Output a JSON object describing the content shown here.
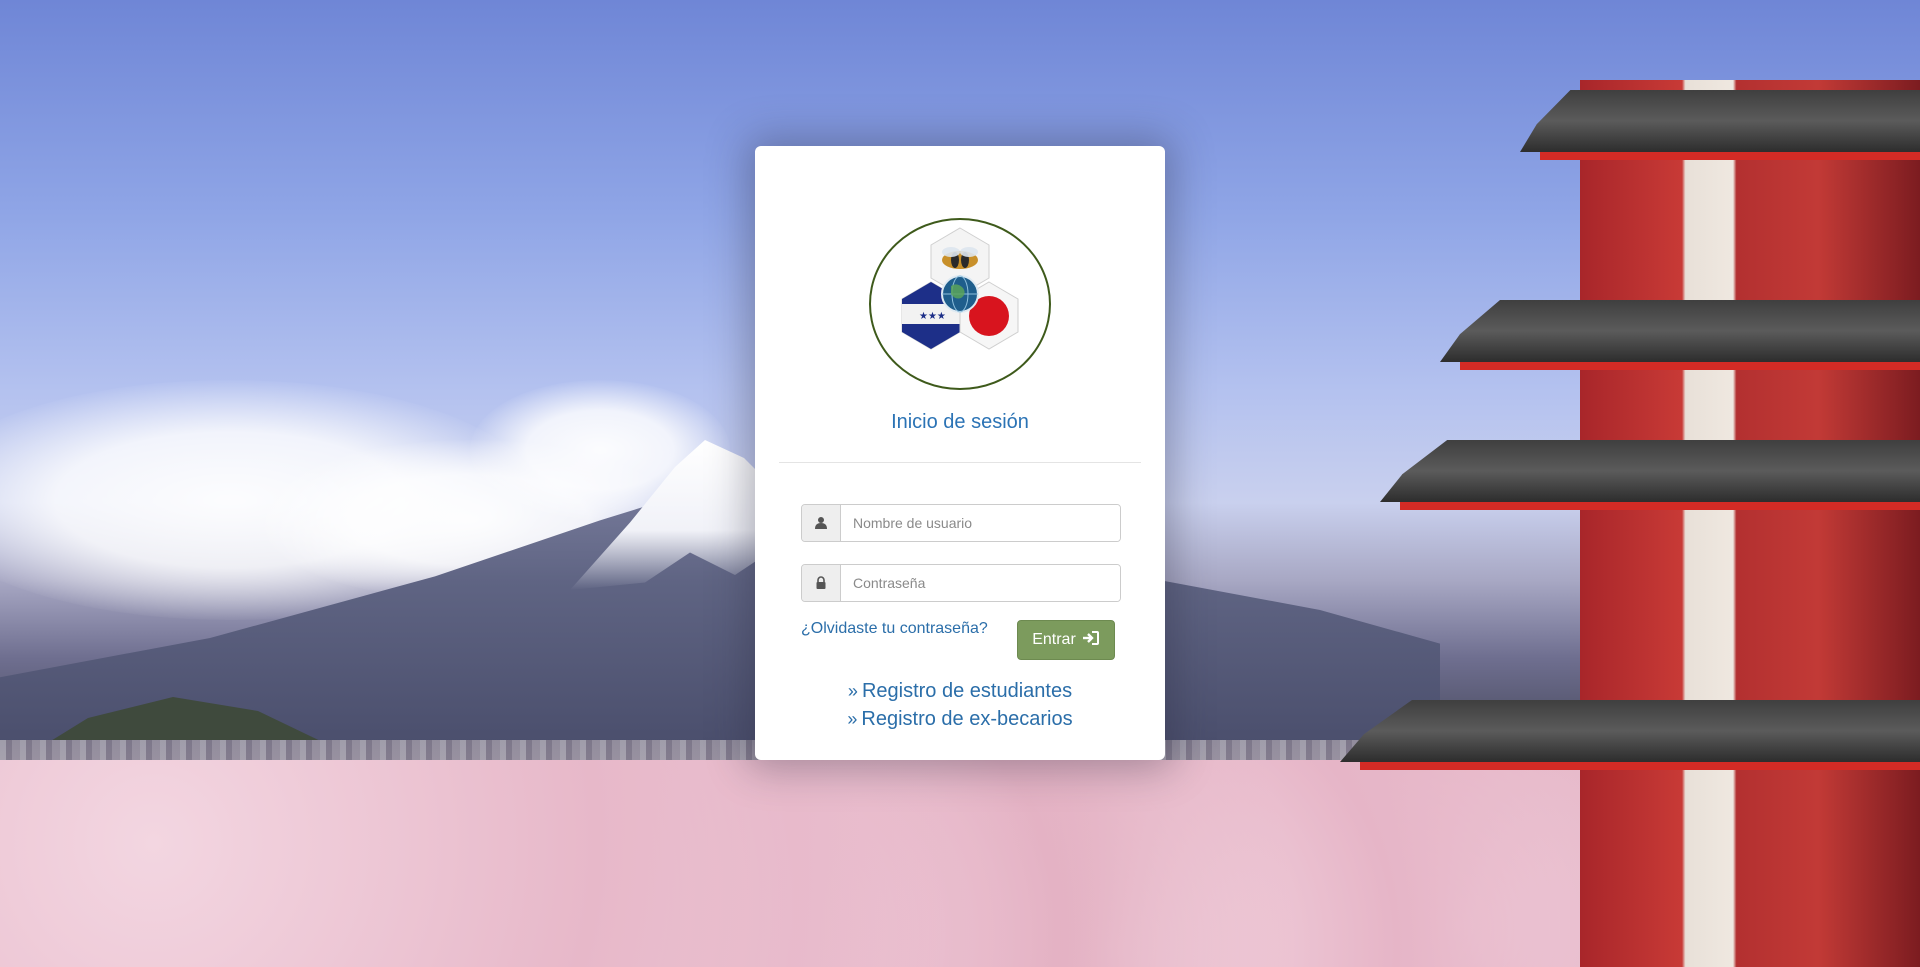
{
  "login": {
    "title": "Inicio de sesión",
    "username": {
      "placeholder": "Nombre de usuario",
      "value": "",
      "icon": "user-icon"
    },
    "password": {
      "placeholder": "Contraseña",
      "value": "",
      "icon": "lock-icon"
    },
    "forgot_label": "¿Olvidaste tu contraseña?",
    "submit_label": "Entrar",
    "submit_icon": "sign-in-icon",
    "links": [
      {
        "label": "Registro de estudiantes",
        "icon": "double-chevron-right-icon"
      },
      {
        "label": "Registro de ex-becarios",
        "icon": "double-chevron-right-icon"
      }
    ]
  },
  "colors": {
    "title": "#2b73b5",
    "link": "#2b6ea9",
    "button": "#7c9b5d",
    "logo_border": "#3e5a1b"
  }
}
